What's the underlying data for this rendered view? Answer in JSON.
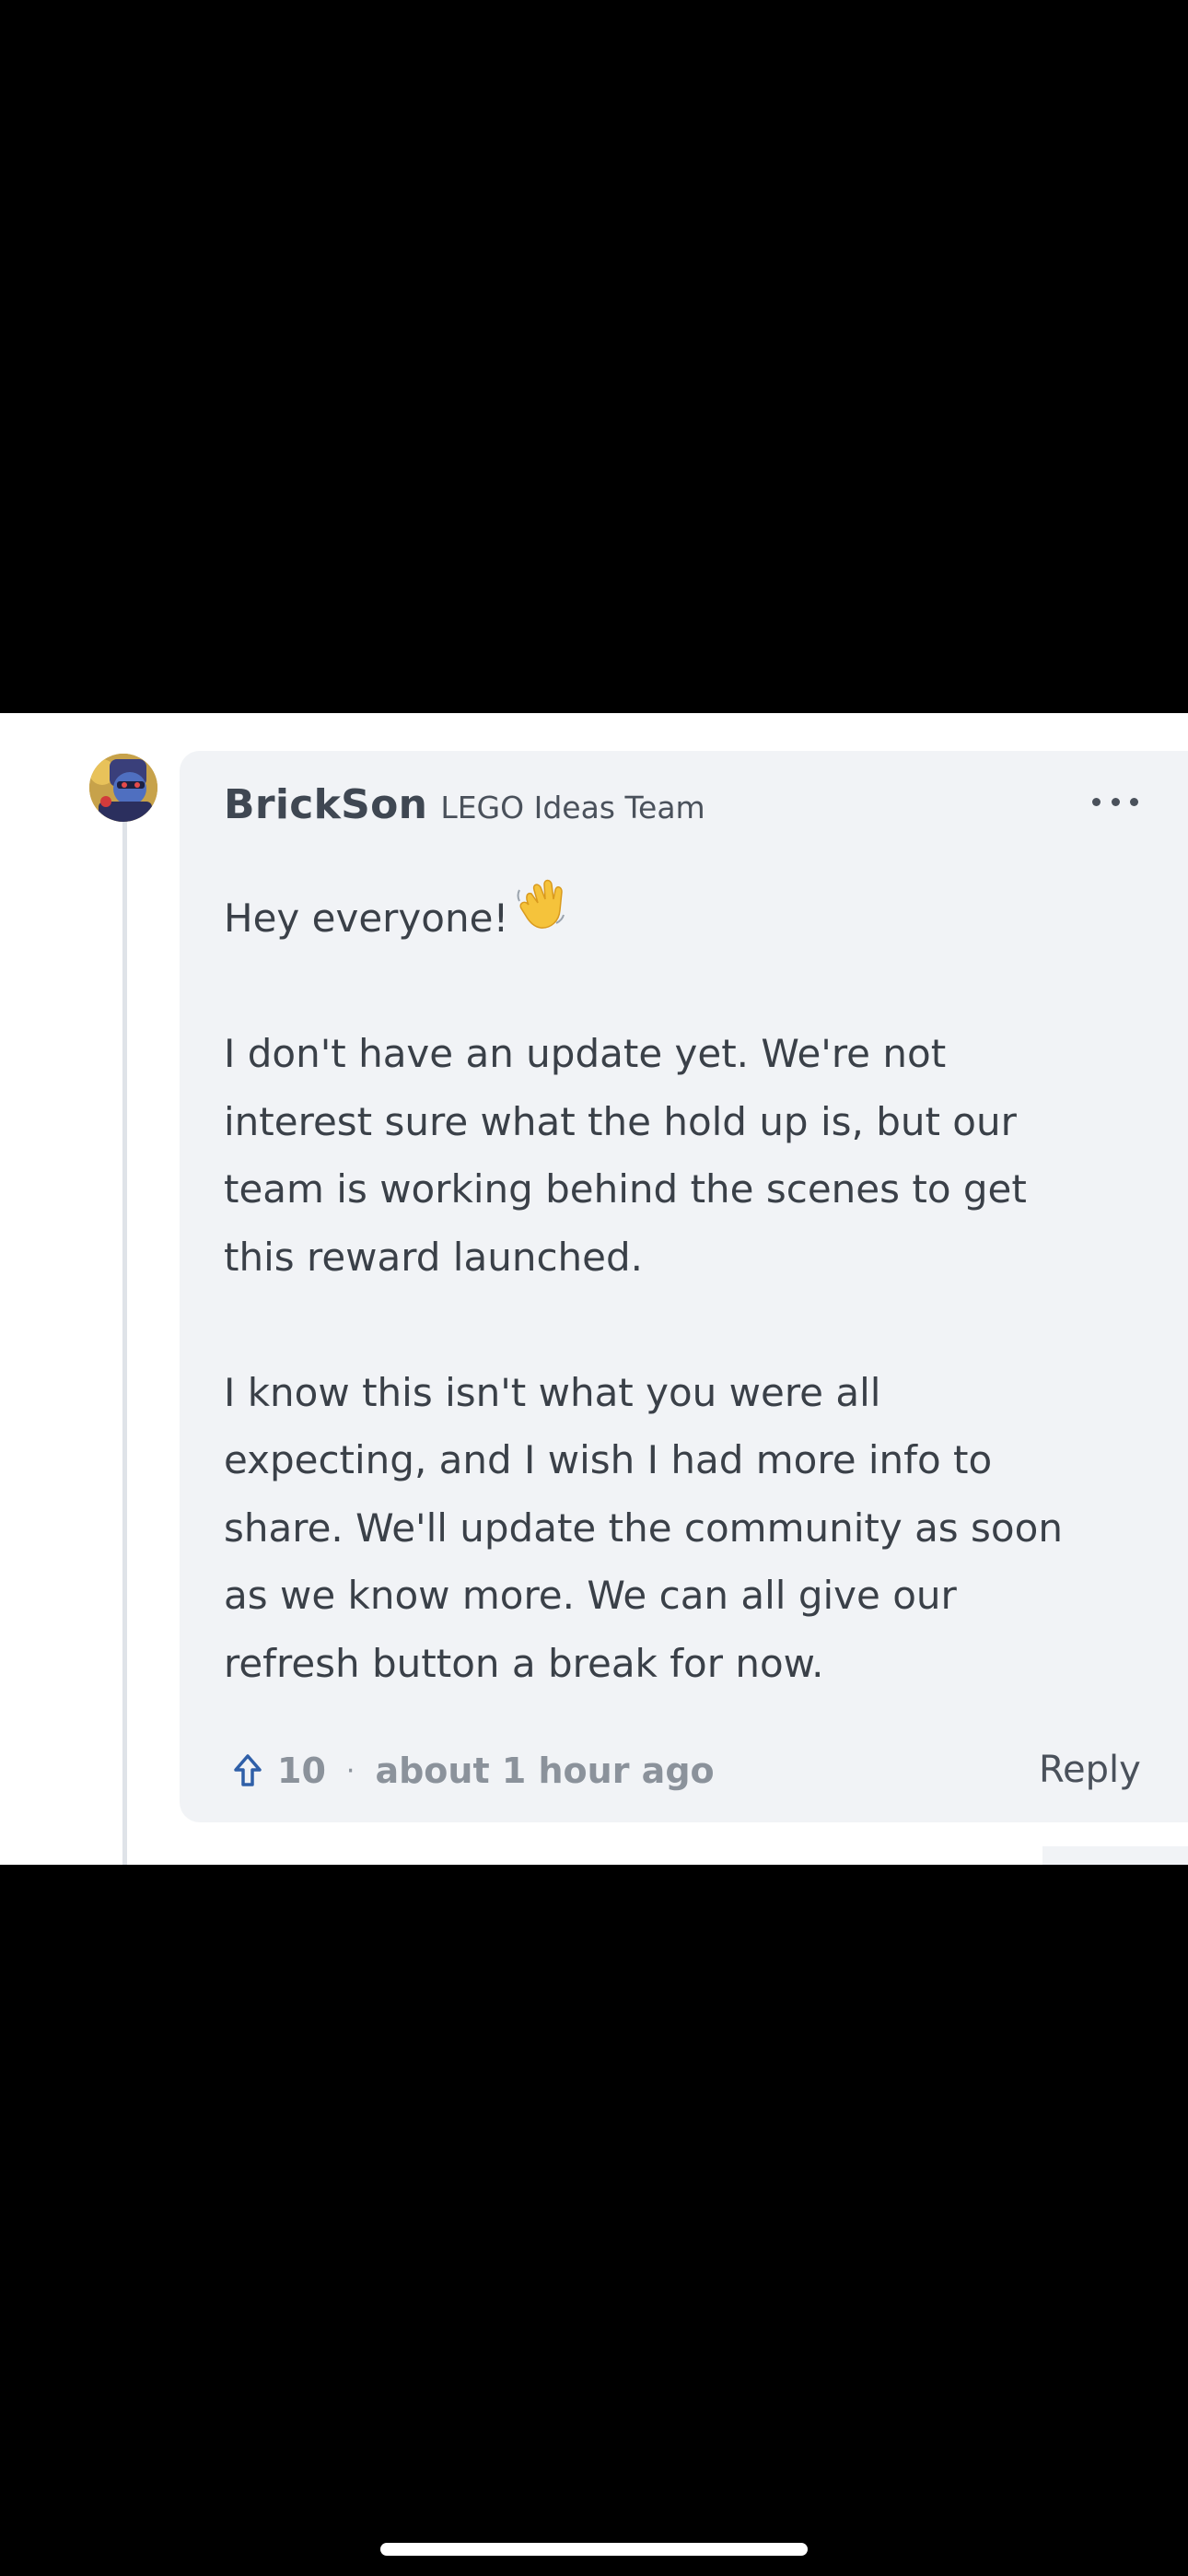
{
  "comment": {
    "author": "BrickSon",
    "role": "LEGO Ideas Team",
    "greeting": "Hey everyone!",
    "greeting_emoji_icon": "waving-hand-icon",
    "paragraph_1": [
      "I don't have an update yet. We're not",
      "interest sure what the hold up is, but our",
      "team is working behind the scenes to get",
      "this reward launched."
    ],
    "paragraph_2": [
      "I know this isn't what you were all",
      "expecting, and I wish I had more info to",
      "share. We'll update the community as soon",
      "as we know more. We can all give our",
      "refresh button a break for now."
    ],
    "upvote_count": "10",
    "separator": "·",
    "timestamp": "about 1 hour ago",
    "reply_label": "Reply",
    "more_options_icon": "more-horizontal-icon",
    "upvote_icon": "arrow-up-outline-icon"
  },
  "colors": {
    "background": "#000000",
    "card": "#f1f3f6",
    "text": "#3a4048",
    "muted": "#8b929b",
    "thread_line": "#dfe3e8"
  }
}
